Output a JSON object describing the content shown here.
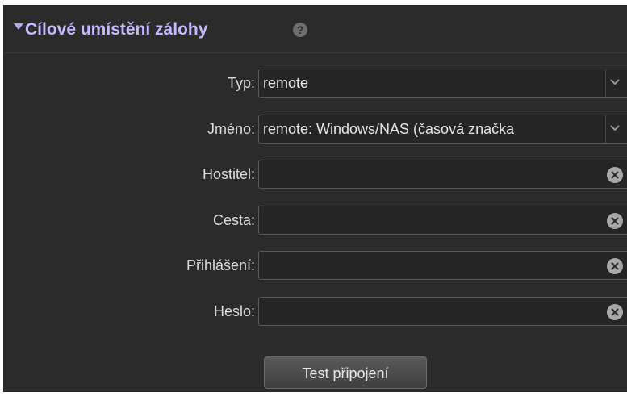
{
  "section": {
    "title": "Cílové umístění zálohy",
    "help_icon": "?"
  },
  "form": {
    "type": {
      "label": "Typ:",
      "value": "remote"
    },
    "name": {
      "label": "Jméno:",
      "value": "remote: Windows/NAS (časová značka"
    },
    "host": {
      "label": "Hostitel:",
      "value": ""
    },
    "path": {
      "label": "Cesta:",
      "value": ""
    },
    "login": {
      "label": "Přihlášení:",
      "value": ""
    },
    "password": {
      "label": "Heslo:",
      "value": ""
    }
  },
  "actions": {
    "test_label": "Test připojení"
  },
  "icons": {
    "collapse": "caret-down-icon",
    "help": "help-icon",
    "dropdown": "chevron-down-icon",
    "clear": "clear-x-icon"
  },
  "colors": {
    "title": "#c4baff",
    "panel_bg": "#2b2b2b",
    "field_bg": "#262626",
    "text": "#dcdcdc"
  }
}
